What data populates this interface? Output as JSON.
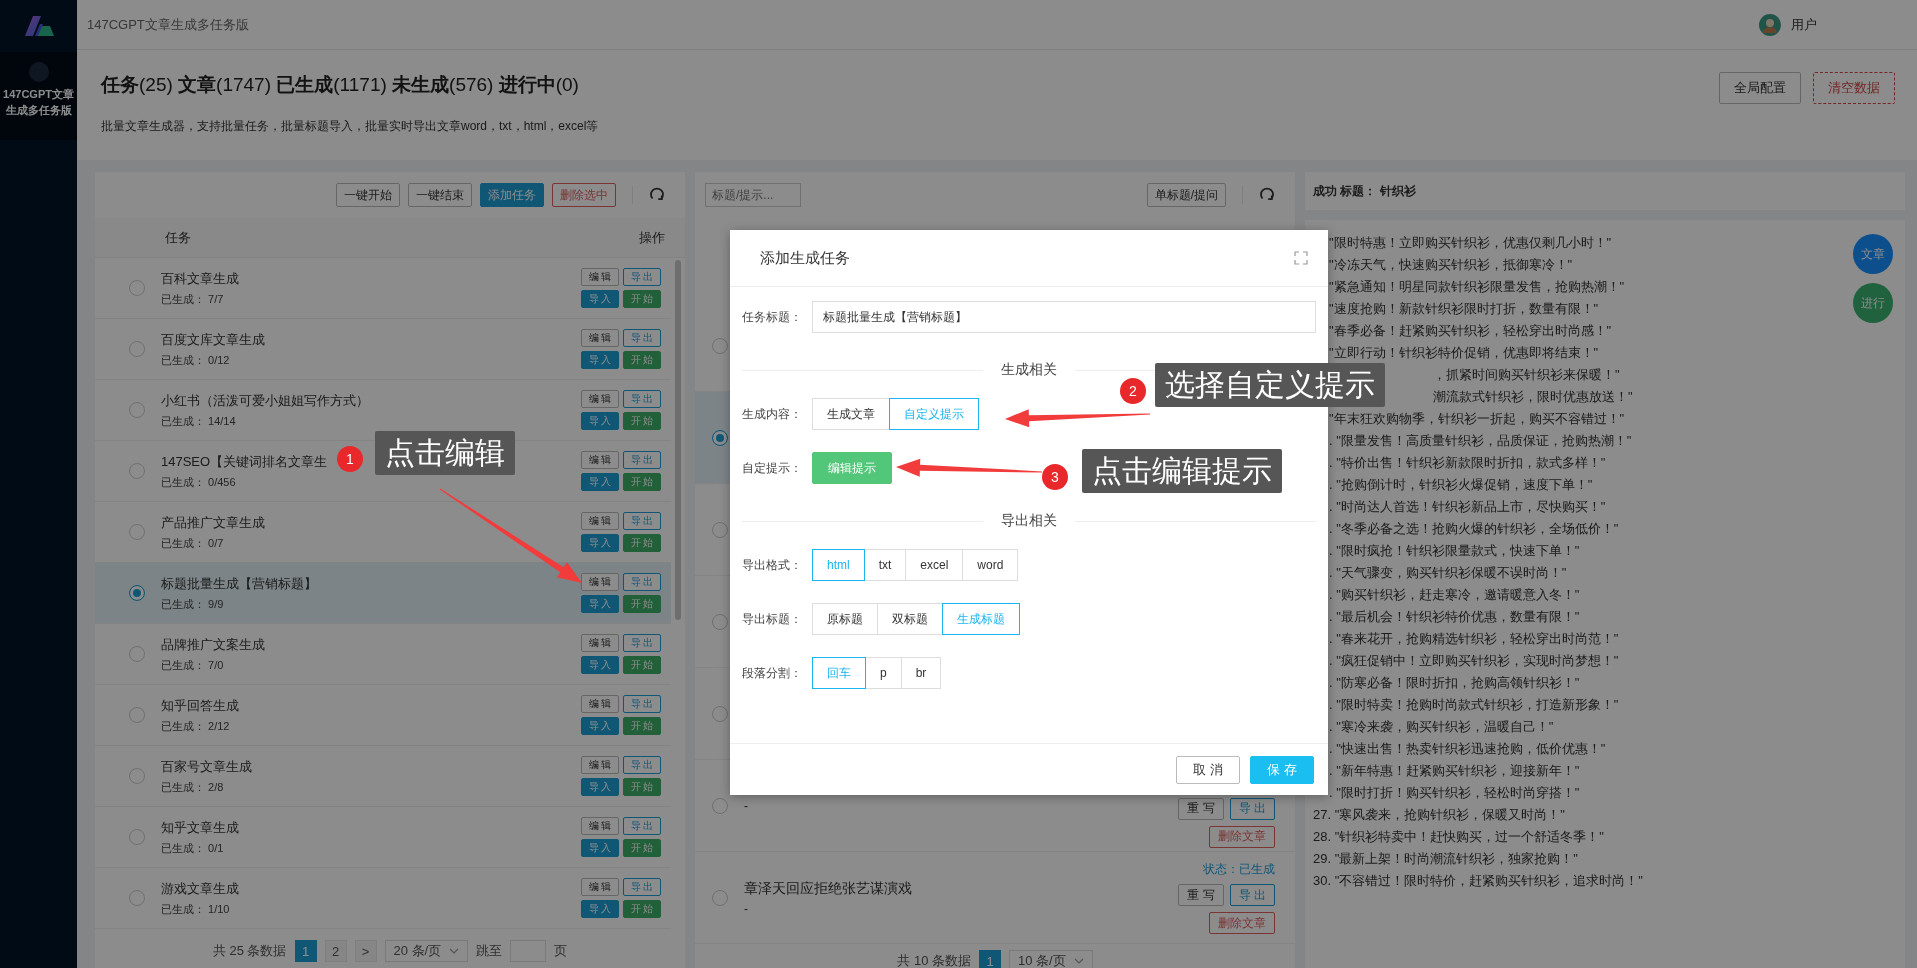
{
  "sidebar": {
    "app_name": "147CGPT文章生成多任务版"
  },
  "topbar": {
    "title": "147CGPT文章生成多任务版",
    "user": "用户"
  },
  "header": {
    "stats": "**任务**(25) **文章**(1747) **已生成**(1171) **未生成**(576) **进行中**(0)",
    "description": "批量文章生成器，支持批量任务，批量标题导入，批量实时导出文章word，txt，html，excel等",
    "buttons": [
      {
        "label": "全局配置",
        "kind": "default"
      },
      {
        "label": "清空数据",
        "kind": "dashed"
      }
    ]
  },
  "task_panel": {
    "toolbar": [
      {
        "label": "一键开始",
        "kind": "default"
      },
      {
        "label": "一键结束",
        "kind": "default"
      },
      {
        "label": "添加任务",
        "kind": "primary"
      },
      {
        "label": "删除选中",
        "kind": "danger"
      }
    ],
    "columns": [
      "任务",
      "操作"
    ],
    "rows": [
      {
        "name": "百科文章生成",
        "progress": "已生成： 7/7",
        "selected": false,
        "actions": [
          {
            "label": "编 辑",
            "kind": "default"
          },
          {
            "label": "导 出",
            "kind": "outline"
          },
          {
            "label": "导 入",
            "kind": "primary"
          },
          {
            "label": "开 始",
            "kind": "success"
          }
        ]
      },
      {
        "name": "百度文库文章生成",
        "progress": "已生成： 0/12",
        "selected": false,
        "actions": [
          {
            "label": "编 辑",
            "kind": "default"
          },
          {
            "label": "导 出",
            "kind": "outline"
          },
          {
            "label": "导 入",
            "kind": "primary"
          },
          {
            "label": "开 始",
            "kind": "success"
          }
        ]
      },
      {
        "name": "小红书（活泼可爱小姐姐写作方式）",
        "progress": "已生成： 14/14",
        "selected": false,
        "actions": [
          {
            "label": "编 辑",
            "kind": "default"
          },
          {
            "label": "导 出",
            "kind": "outline"
          },
          {
            "label": "导 入",
            "kind": "primary"
          },
          {
            "label": "开 始",
            "kind": "success"
          }
        ]
      },
      {
        "name": "147SEO【关键词排名文章生",
        "progress": "已生成： 0/456",
        "selected": false,
        "actions": [
          {
            "label": "编 辑",
            "kind": "default"
          },
          {
            "label": "导 出",
            "kind": "outline"
          },
          {
            "label": "导 入",
            "kind": "primary"
          },
          {
            "label": "开 始",
            "kind": "success"
          }
        ]
      },
      {
        "name": "产品推广文章生成",
        "progress": "已生成： 0/7",
        "selected": false,
        "actions": [
          {
            "label": "编 辑",
            "kind": "default"
          },
          {
            "label": "导 出",
            "kind": "outline"
          },
          {
            "label": "导 入",
            "kind": "primary"
          },
          {
            "label": "开 始",
            "kind": "success"
          }
        ]
      },
      {
        "name": "标题批量生成【营销标题】",
        "progress": "已生成： 9/9",
        "selected": true,
        "actions": [
          {
            "label": "编 辑",
            "kind": "default"
          },
          {
            "label": "导 出",
            "kind": "outline"
          },
          {
            "label": "导 入",
            "kind": "primary"
          },
          {
            "label": "开 始",
            "kind": "success"
          }
        ]
      },
      {
        "name": "品牌推广文案生成",
        "progress": "已生成： 7/0",
        "selected": false,
        "actions": [
          {
            "label": "编 辑",
            "kind": "default"
          },
          {
            "label": "导 出",
            "kind": "outline"
          },
          {
            "label": "导 入",
            "kind": "primary"
          },
          {
            "label": "开 始",
            "kind": "success"
          }
        ]
      },
      {
        "name": "知乎回答生成",
        "progress": "已生成： 2/12",
        "selected": false,
        "actions": [
          {
            "label": "编 辑",
            "kind": "default"
          },
          {
            "label": "导 出",
            "kind": "outline"
          },
          {
            "label": "导 入",
            "kind": "primary"
          },
          {
            "label": "开 始",
            "kind": "success"
          }
        ]
      },
      {
        "name": "百家号文章生成",
        "progress": "已生成： 2/8",
        "selected": false,
        "actions": [
          {
            "label": "编 辑",
            "kind": "default"
          },
          {
            "label": "导 出",
            "kind": "outline"
          },
          {
            "label": "导 入",
            "kind": "primary"
          },
          {
            "label": "开 始",
            "kind": "success"
          }
        ]
      },
      {
        "name": "知乎文章生成",
        "progress": "已生成： 0/1",
        "selected": false,
        "actions": [
          {
            "label": "编 辑",
            "kind": "default"
          },
          {
            "label": "导 出",
            "kind": "outline"
          },
          {
            "label": "导 入",
            "kind": "primary"
          },
          {
            "label": "开 始",
            "kind": "success"
          }
        ]
      },
      {
        "name": "游戏文章生成",
        "progress": "已生成： 1/10",
        "selected": false,
        "actions": [
          {
            "label": "编 辑",
            "kind": "default"
          },
          {
            "label": "导 出",
            "kind": "outline"
          },
          {
            "label": "导 入",
            "kind": "primary"
          },
          {
            "label": "开 始",
            "kind": "success"
          }
        ]
      }
    ],
    "pagination": {
      "total": "共 25 条数据",
      "pages": [
        {
          "label": "1",
          "selected": true
        },
        {
          "label": "2",
          "selected": false
        }
      ],
      "next": ">",
      "page_size": "20 条/页",
      "jump_label": "跳至",
      "page_unit": "页"
    }
  },
  "article_panel": {
    "search": {
      "placeholder": "标题/提示..."
    },
    "toolbar": [
      {
        "label": "单标题/提问",
        "kind": "default"
      }
    ],
    "rows": [
      {
        "selected": false
      },
      {
        "selected": true
      },
      {
        "selected": false
      },
      {
        "selected": false
      },
      {
        "selected": false
      },
      {
        "selected": false,
        "subtitle": "-",
        "actions": [
          {
            "label": "重 写",
            "kind": "default"
          },
          {
            "label": "导 出",
            "kind": "outline"
          },
          {
            "label": "删除文章",
            "kind": "danger"
          }
        ]
      },
      {
        "selected": false,
        "title": "章泽天回应拒绝张艺谋演戏",
        "subtitle": "-",
        "status": "状态：已生成",
        "actions": [
          {
            "label": "重 写",
            "kind": "default"
          },
          {
            "label": "导 出",
            "kind": "outline"
          },
          {
            "label": "删除文章",
            "kind": "danger"
          }
        ]
      }
    ],
    "pagination": {
      "total": "共 10 条数据",
      "pages": [
        {
          "label": "1",
          "selected": true
        }
      ],
      "page_size": "10 条/页"
    }
  },
  "result_panel": {
    "header": "成功 标题： 针织衫",
    "float_buttons": [
      {
        "label": "文章",
        "kind": "primary"
      },
      {
        "label": "进行",
        "kind": "success"
      }
    ],
    "lines": [
      {
        "kind": "cut",
        "text": "\"限时特惠！立即购买针织衫，优惠仅剩几小时！\""
      },
      {
        "kind": "cut",
        "text": "\"冷冻天气，快速购买针织衫，抵御寒冷！\""
      },
      {
        "kind": "cut",
        "text": "\"紧急通知！明星同款针织衫限量发售，抢购热潮！\""
      },
      {
        "kind": "cut",
        "text": "\"速度抢购！新款针织衫限时打折，数量有限！\""
      },
      {
        "kind": "cut",
        "text": "\"春季必备！赶紧购买针织衫，轻松穿出时尚感！\""
      },
      {
        "kind": "cut",
        "text": "\"立即行动！针织衫特价促销，优惠即将结束！\""
      },
      {
        "kind": "covered",
        "text": "，抓紧时间购买针织衫来保暖！\""
      },
      {
        "kind": "covered",
        "text": "潮流款式针织衫，限时优惠放送！\""
      },
      {
        "kind": "cut",
        "text": "\"年末狂欢购物季，针织衫一折起，购买不容错过！\""
      },
      {
        "kind": "cut",
        "text": ". \"限量发售！高质量针织衫，品质保证，抢购热潮！\""
      },
      {
        "kind": "cut",
        "text": ". \"特价出售！针织衫新款限时折扣，款式多样！\""
      },
      {
        "kind": "cut",
        "text": ". \"抢购倒计时，针织衫火爆促销，速度下单！\""
      },
      {
        "kind": "cut",
        "text": ". \"时尚达人首选！针织衫新品上市，尽快购买！\""
      },
      {
        "kind": "cut",
        "text": ". \"冬季必备之选！抢购火爆的针织衫，全场低价！\""
      },
      {
        "kind": "cut",
        "text": ". \"限时疯抢！针织衫限量款式，快速下单！\""
      },
      {
        "kind": "cut",
        "text": ". \"天气骤变，购买针织衫保暖不误时尚！\""
      },
      {
        "kind": "cut",
        "text": ". \"购买针织衫，赶走寒冷，邀请暖意入冬！\""
      },
      {
        "kind": "cut",
        "text": ". \"最后机会！针织衫特价优惠，数量有限！\""
      },
      {
        "kind": "cut",
        "text": ". \"春来花开，抢购精选针织衫，轻松穿出时尚范！\""
      },
      {
        "kind": "cut",
        "text": ". \"疯狂促销中！立即购买针织衫，实现时尚梦想！\""
      },
      {
        "kind": "cut",
        "text": ". \"防寒必备！限时折扣，抢购高领针织衫！\""
      },
      {
        "kind": "cut",
        "text": ". \"限时特卖！抢购时尚款式针织衫，打造新形象！\""
      },
      {
        "kind": "cut",
        "text": ". \"寒冷来袭，购买针织衫，温暖自己！\""
      },
      {
        "kind": "cut",
        "text": ". \"快速出售！热卖针织衫迅速抢购，低价优惠！\""
      },
      {
        "kind": "cut",
        "text": ". \"新年特惠！赶紧购买针织衫，迎接新年！\""
      },
      {
        "kind": "cut",
        "text": ". \"限时打折！购买针织衫，轻松时尚穿搭！\""
      },
      {
        "kind": "full",
        "text": "27. \"寒风袭来，抢购针织衫，保暖又时尚！\""
      },
      {
        "kind": "full",
        "text": "28. \"针织衫特卖中！赶快购买，过一个舒适冬季！\""
      },
      {
        "kind": "full",
        "text": "29. \"最新上架！时尚潮流针织衫，独家抢购！\""
      },
      {
        "kind": "full",
        "text": "30. \"不容错过！限时特价，赶紧购买针织衫，追求时尚！\""
      }
    ]
  },
  "modal": {
    "title": "添加生成任务",
    "fields": [
      {
        "kind": "input",
        "label": "任务标题：",
        "value": "标题批量生成【营销标题】"
      },
      {
        "kind": "divider",
        "label": "生成相关"
      },
      {
        "kind": "segmented",
        "label": "生成内容：",
        "options": [
          {
            "label": "生成文章",
            "selected": false
          },
          {
            "label": "自定义提示",
            "selected": true
          }
        ]
      },
      {
        "kind": "button",
        "label": "自定提示：",
        "button": "编辑提示"
      },
      {
        "kind": "divider",
        "label": "导出相关"
      },
      {
        "kind": "segmented",
        "label": "导出格式：",
        "options": [
          {
            "label": "html",
            "selected": true
          },
          {
            "label": "txt",
            "selected": false
          },
          {
            "label": "excel",
            "selected": false
          },
          {
            "label": "word",
            "selected": false
          }
        ]
      },
      {
        "kind": "segmented",
        "label": "导出标题：",
        "options": [
          {
            "label": "原标题",
            "selected": false
          },
          {
            "label": "双标题",
            "selected": false
          },
          {
            "label": "生成标题",
            "selected": true
          }
        ]
      },
      {
        "kind": "segmented",
        "label": "段落分割：",
        "options": [
          {
            "label": "回车",
            "selected": true
          },
          {
            "label": "p",
            "selected": false
          },
          {
            "label": "br",
            "selected": false
          }
        ]
      }
    ],
    "buttons": [
      {
        "label": "取 消",
        "kind": "default"
      },
      {
        "label": "保 存",
        "kind": "save"
      }
    ]
  },
  "callouts": [
    {
      "number": "1",
      "text": "点击编辑"
    },
    {
      "number": "2",
      "text": "选择自定义提示"
    },
    {
      "number": "3",
      "text": "点击编辑提示"
    }
  ]
}
